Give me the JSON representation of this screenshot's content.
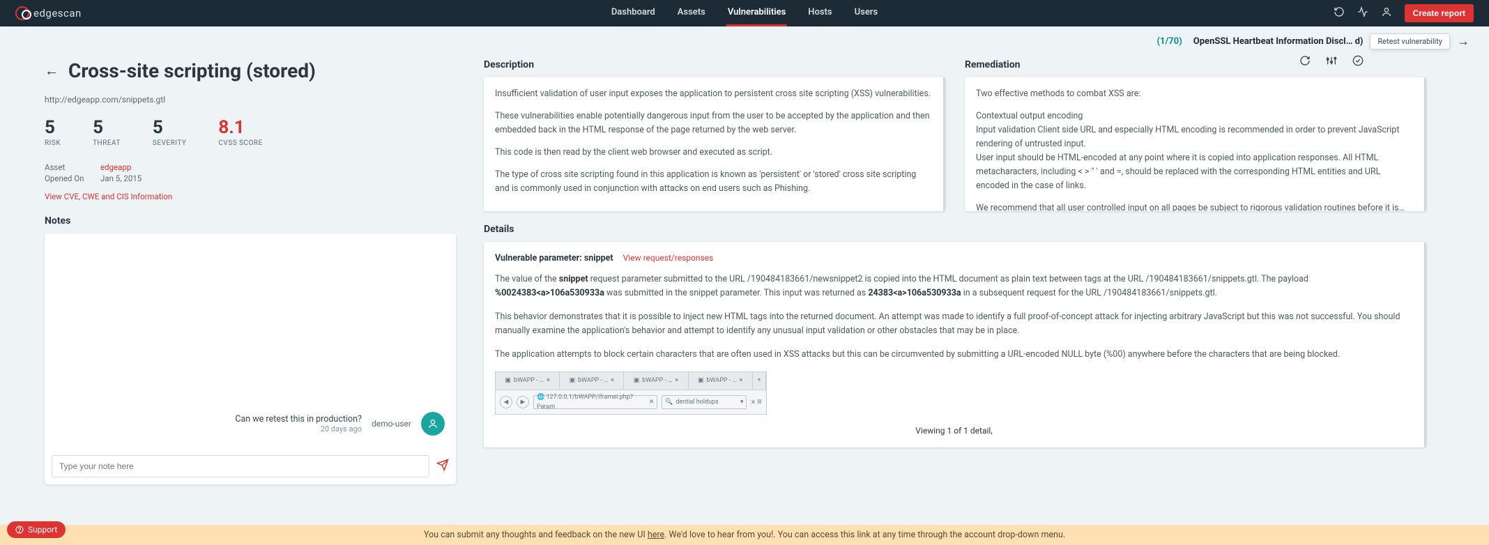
{
  "brand": "edgescan",
  "nav": {
    "dashboard": "Dashboard",
    "assets": "Assets",
    "vulnerabilities": "Vulnerabilities",
    "hosts": "Hosts",
    "users": "Users"
  },
  "create_report": "Create report",
  "pager": {
    "count": "(1/70)",
    "title": "OpenSSL Heartbeat Information Discl… d)",
    "tooltip": "Retest vulnerability"
  },
  "title": "Cross-site scripting (stored)",
  "url": "http://edgeapp.com/snippets.gtl",
  "scores": {
    "risk": {
      "val": "5",
      "label": "RISK"
    },
    "threat": {
      "val": "5",
      "label": "THREAT"
    },
    "severity": {
      "val": "5",
      "label": "SEVERITY"
    },
    "cvss": {
      "val": "8.1",
      "label": "CVSS SCORE"
    }
  },
  "asset": {
    "asset_label": "Asset",
    "asset_value": "edgeapp",
    "opened_label": "Opened On",
    "opened_value": "Jan 5, 2015"
  },
  "cve_link": "View CVE, CWE and CIS Information",
  "notes_heading": "Notes",
  "note": {
    "msg": "Can we retest this in production?",
    "time": "20 days ago",
    "user": "demo-user"
  },
  "note_placeholder": "Type your note here",
  "desc_heading": "Description",
  "desc": {
    "p1": "Insufficient validation of user input exposes the application to persistent cross site scripting (XSS) vulnerabilities.",
    "p2": "These vulnerabilities enable potentially dangerous input from the user to be accepted by the application and then embedded back in the HTML response of the page returned by the web server.",
    "p3": "This code is then read by the client web browser and executed as script.",
    "p4": "The type of cross site scripting found in this application is known as 'persistent' or 'stored' cross site scripting and is commonly used in conjunction with attacks on end users such as Phishing."
  },
  "rem_heading": "Remediation",
  "rem": {
    "p1": "Two effective methods to combat XSS are:",
    "p2": "Contextual output encoding",
    "p3": "Input validation Client side URL and especially HTML encoding is recommended in order to prevent JavaScript rendering of untrusted input.",
    "p4": "User input should be HTML-encoded at any point where it is copied into application responses. All HTML metacharacters, including < > \" ' and =, should be replaced with the corresponding HTML entities and URL encoded in the case of links.",
    "p5": "We recommend that all user controlled input on all pages be subject to rigorous validation routines before it is…"
  },
  "details_heading": "Details",
  "details": {
    "vp_label": "Vulnerable parameter: snippet",
    "vp_link": "View request/responses",
    "p1a": "The value of the ",
    "p1b": "snippet",
    "p1c": " request parameter submitted to the URL /190484183661/newsnippet2 is copied into the HTML document as plain text between tags at the URL /190484183661/snippets.gtl. The payload ",
    "p1d": "%0024383<a>106a530933a",
    "p1e": " was submitted in the snippet parameter. This input was returned as ",
    "p1f": "24383<a>106a530933a",
    "p1g": " in a subsequent request for the URL /190484183661/snippets.gtl.",
    "p2": "This behavior demonstrates that it is possible to inject new HTML tags into the returned document. An attempt was made to identify a full proof-of-concept attack for injecting arbitrary JavaScript but this was not successful. You should manually examine the application's behavior and attempt to identify any unusual input validation or other obstacles that may be in place.",
    "p3": "The application attempts to block certain characters that are often used in XSS attacks but this can be circumvented by submitting a URL-encoded NULL byte (%00) anywhere before the characters that are being blocked."
  },
  "screenshot": {
    "tab": "bWAPP - …",
    "url": "127.0.0.1/bWAPP/iframei.php?Param",
    "search": "dential holdups"
  },
  "viewing": "Viewing 1 of 1 detail,",
  "feedback": {
    "pre": "You can submit any thoughts and feedback on the new UI ",
    "link": "here",
    "post": ". We'd love to hear from you!.  You can access this link at any time through the account drop-down menu."
  },
  "support": "Support"
}
